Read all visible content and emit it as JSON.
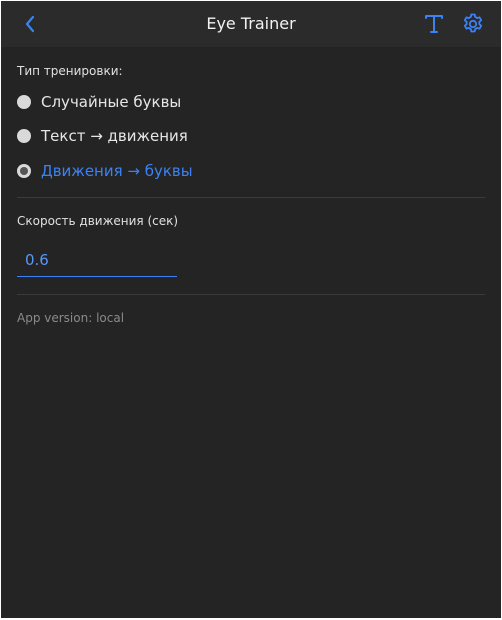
{
  "header": {
    "title": "Eye Trainer",
    "back_icon": "chevron-left-icon",
    "text_icon": "text-T-icon",
    "settings_icon": "gear-icon",
    "accent_color": "#3b82f6"
  },
  "training": {
    "label": "Тип тренировки:",
    "options": [
      {
        "label": "Случайные буквы",
        "selected": false
      },
      {
        "label": "Текст → движения",
        "selected": false
      },
      {
        "label": "Движения → буквы",
        "selected": true
      }
    ]
  },
  "speed": {
    "label": "Скорость движения (сек)",
    "value": "0.6"
  },
  "footer": {
    "version": "App version: local"
  }
}
